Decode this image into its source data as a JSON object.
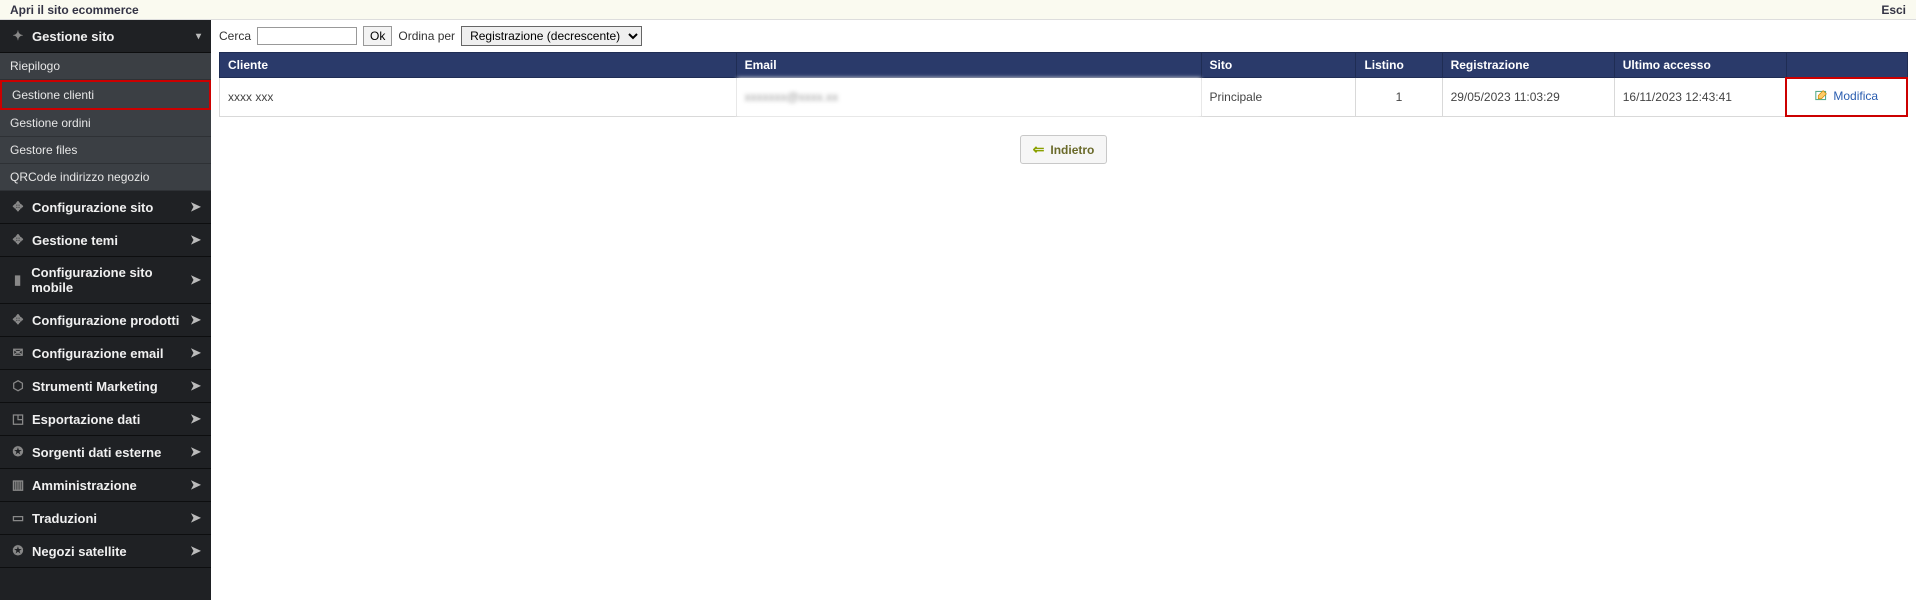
{
  "topbar": {
    "open_site": "Apri il sito ecommerce",
    "logout": "Esci"
  },
  "sidebar": {
    "section0": {
      "label": "Gestione sito"
    },
    "sub": {
      "riepilogo": "Riepilogo",
      "gestione_clienti": "Gestione clienti",
      "gestione_ordini": "Gestione ordini",
      "gestore_files": "Gestore files",
      "qrcode": "QRCode indirizzo negozio"
    },
    "config_sito": "Configurazione sito",
    "gestione_temi": "Gestione temi",
    "config_mobile": "Configurazione sito mobile",
    "config_prodotti": "Configurazione prodotti",
    "config_email": "Configurazione email",
    "strumenti_marketing": "Strumenti Marketing",
    "esportazione_dati": "Esportazione dati",
    "sorgenti_esterne": "Sorgenti dati esterne",
    "amministrazione": "Amministrazione",
    "traduzioni": "Traduzioni",
    "negozi_satellite": "Negozi satellite"
  },
  "search": {
    "label": "Cerca",
    "ok": "Ok",
    "order_by": "Ordina per",
    "order_value": "Registrazione (decrescente)"
  },
  "table": {
    "headers": {
      "cliente": "Cliente",
      "email": "Email",
      "sito": "Sito",
      "listino": "Listino",
      "registrazione": "Registrazione",
      "ultimo_accesso": "Ultimo accesso",
      "azioni": ""
    },
    "rows": [
      {
        "cliente": "xxxx xxx",
        "email": "xxxxxxx@xxxx.xx",
        "sito": "Principale",
        "listino": "1",
        "registrazione": "29/05/2023 11:03:29",
        "ultimo_accesso": "16/11/2023 12:43:41",
        "modifica": "Modifica"
      }
    ]
  },
  "buttons": {
    "indietro": "Indietro"
  }
}
